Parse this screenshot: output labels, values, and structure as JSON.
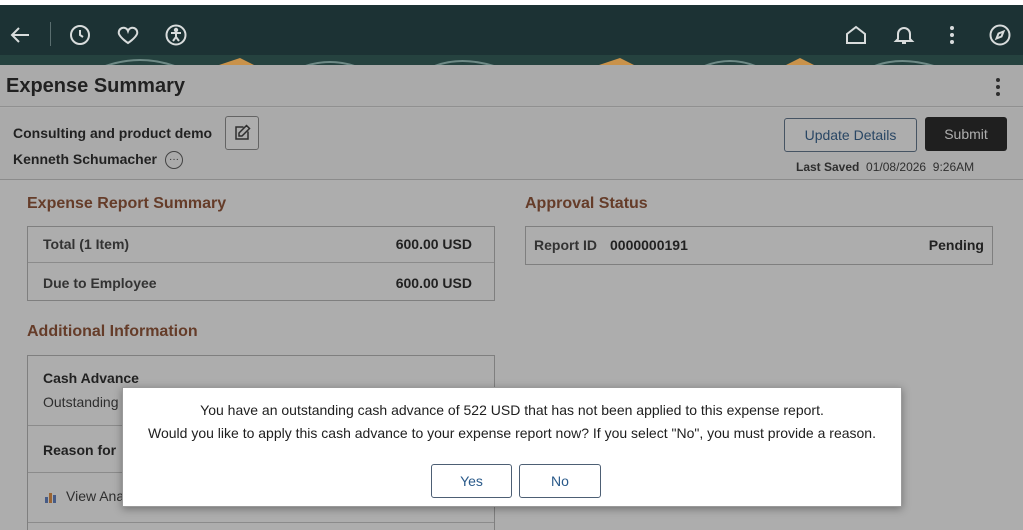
{
  "nav": {
    "icons": [
      "back-arrow-icon",
      "history-icon",
      "heart-icon",
      "accessibility-icon",
      "home-icon",
      "bell-icon",
      "kebab-icon",
      "compass-icon"
    ]
  },
  "page": {
    "title": "Expense Summary"
  },
  "header": {
    "report_description": "Consulting and product demo",
    "employee_name": "Kenneth Schumacher",
    "update_label": "Update Details",
    "submit_label": "Submit",
    "last_saved_label": "Last Saved",
    "last_saved_value": "01/08/2026  9:26AM"
  },
  "summary": {
    "title": "Expense Report Summary",
    "rows": [
      {
        "label": "Total (1 Item)",
        "value": "600.00 USD"
      },
      {
        "label": "Due to Employee",
        "value": "600.00 USD"
      }
    ]
  },
  "approval": {
    "title": "Approval Status",
    "report_id_label": "Report ID",
    "report_id": "0000000191",
    "status": "Pending"
  },
  "additional": {
    "title": "Additional Information",
    "cash_advance_label": "Cash Advance",
    "cash_advance_sub": "Outstanding",
    "reason_label": "Reason for",
    "view_label": "View Ana"
  },
  "modal": {
    "line1": "You have an outstanding cash advance of 522 USD that has not been applied to this expense report.",
    "line2": "Would you like to apply this cash advance to your expense report now? If you select \"No\", you must provide a reason.",
    "yes_label": "Yes",
    "no_label": "No"
  },
  "colors": {
    "topbar": "#1c3234",
    "section_title": "#8b4a2b",
    "link": "#2a5a8a",
    "submit_bg": "#1b1b1b"
  }
}
